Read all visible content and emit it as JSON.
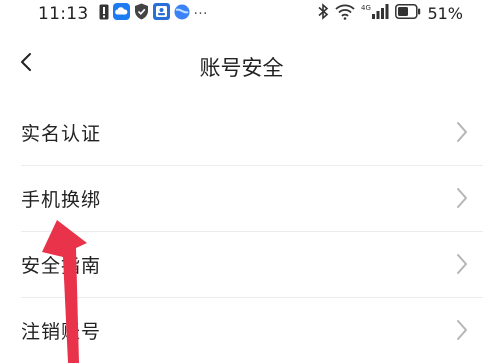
{
  "status_bar": {
    "time": "11:13",
    "more_indicator": "···",
    "battery_percent": "51%",
    "network_label": "4G"
  },
  "header": {
    "title": "账号安全"
  },
  "menu": {
    "items": [
      {
        "label": "实名认证"
      },
      {
        "label": "手机换绑"
      },
      {
        "label": "安全指南"
      },
      {
        "label": "注销账号"
      }
    ]
  },
  "annotation": {
    "arrow_color": "#e8334a"
  }
}
